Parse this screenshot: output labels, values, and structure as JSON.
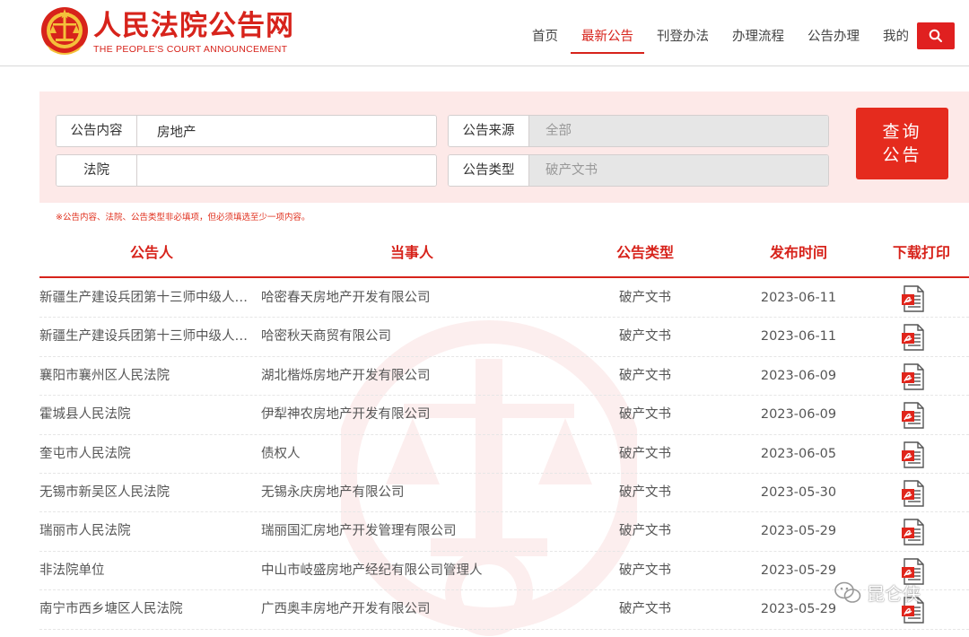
{
  "header": {
    "title": "人民法院公告网",
    "subtitle": "THE PEOPLE'S COURT ANNOUNCEMENT",
    "nav": [
      "首页",
      "最新公告",
      "刊登办法",
      "办理流程",
      "公告办理",
      "我的"
    ],
    "active_nav": 1
  },
  "search": {
    "content_label": "公告内容",
    "content_value": "房地产",
    "court_label": "法院",
    "court_value": "",
    "source_label": "公告来源",
    "source_value": "全部",
    "type_label": "公告类型",
    "type_value": "破产文书",
    "query_button": "查询\n公告",
    "hint": "※公告内容、法院、公告类型非必填项，但必须填选至少一项内容。"
  },
  "table": {
    "headers": [
      "公告人",
      "当事人",
      "公告类型",
      "发布时间",
      "下载打印"
    ],
    "rows": [
      {
        "announcer": "新疆生产建设兵团第十三师中级人民法院",
        "party": "哈密春天房地产开发有限公司",
        "type": "破产文书",
        "date": "2023-06-11"
      },
      {
        "announcer": "新疆生产建设兵团第十三师中级人民法院",
        "party": "哈密秋天商贸有限公司",
        "type": "破产文书",
        "date": "2023-06-11"
      },
      {
        "announcer": "襄阳市襄州区人民法院",
        "party": "湖北楷烁房地产开发有限公司",
        "type": "破产文书",
        "date": "2023-06-09"
      },
      {
        "announcer": "霍城县人民法院",
        "party": "伊犁神农房地产开发有限公司",
        "type": "破产文书",
        "date": "2023-06-09"
      },
      {
        "announcer": "奎屯市人民法院",
        "party": "债权人",
        "type": "破产文书",
        "date": "2023-06-05"
      },
      {
        "announcer": "无锡市新吴区人民法院",
        "party": "无锡永庆房地产有限公司",
        "type": "破产文书",
        "date": "2023-05-30"
      },
      {
        "announcer": "瑞丽市人民法院",
        "party": "瑞丽国汇房地产开发管理有限公司",
        "type": "破产文书",
        "date": "2023-05-29"
      },
      {
        "announcer": "非法院单位",
        "party": "中山市岐盛房地产经纪有限公司管理人",
        "type": "破产文书",
        "date": "2023-05-29"
      },
      {
        "announcer": "南宁市西乡塘区人民法院",
        "party": "广西奥丰房地产开发有限公司",
        "type": "破产文书",
        "date": "2023-05-29"
      }
    ]
  },
  "watermark": {
    "text": "昆仑侠"
  },
  "colors": {
    "brand_red": "#d7231b",
    "panel_bg": "#fde9e8"
  },
  "icons": {
    "search": "search-icon",
    "download": "pdf-document-icon",
    "emblem": "court-emblem-icon",
    "wechat": "wechat-icon"
  }
}
